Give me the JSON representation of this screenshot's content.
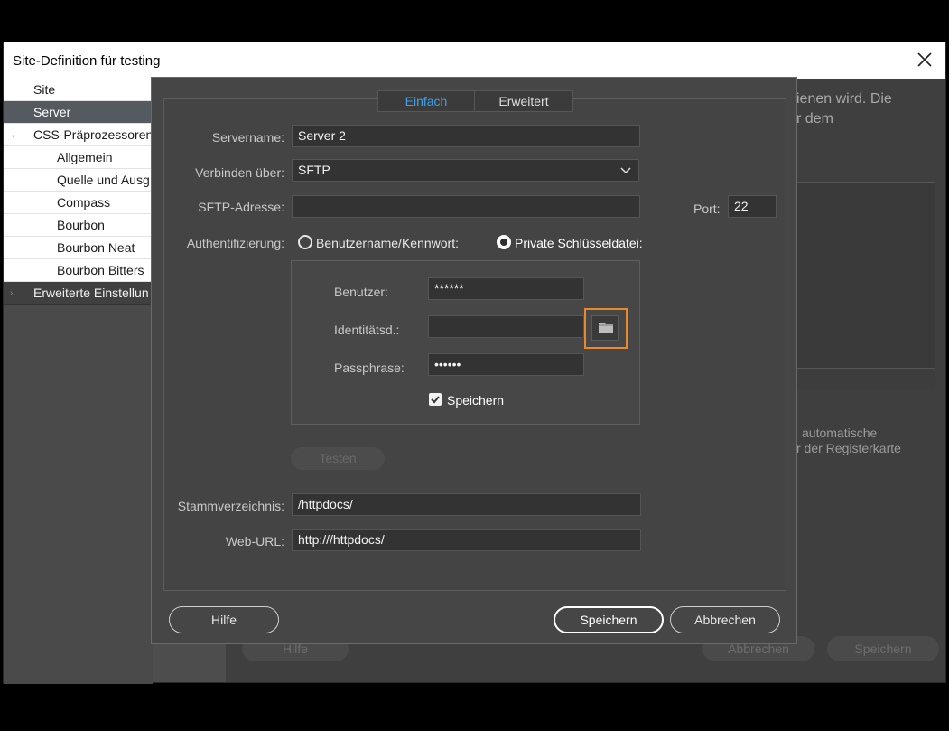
{
  "window": {
    "title": "Site-Definition für testing",
    "close_icon": "close-icon"
  },
  "nav": {
    "items": [
      {
        "label": "Site",
        "selected": false
      },
      {
        "label": "Server",
        "selected": true
      },
      {
        "label": "CSS-Präprozessoren",
        "selected": false,
        "expanded": true
      },
      {
        "label": "Allgemein",
        "selected": false
      },
      {
        "label": "Quelle und Ausg",
        "selected": false
      },
      {
        "label": "Compass",
        "selected": false
      },
      {
        "label": "Bourbon",
        "selected": false
      },
      {
        "label": "Bourbon Neat",
        "selected": false
      },
      {
        "label": "Bourbon Bitters",
        "selected": false
      },
      {
        "label": "Erweiterte Einstellun",
        "selected": false
      }
    ]
  },
  "background": {
    "text_line1": "ienen wird. Die",
    "text_line2": "r dem",
    "text_line3": "automatische",
    "text_line4": "r der Registerkarte",
    "help_label": "Hilfe",
    "cancel_label": "Abbrechen",
    "save_label": "Speichern"
  },
  "dialog": {
    "tabs": [
      {
        "label": "Einfach",
        "active": true
      },
      {
        "label": "Erweitert",
        "active": false
      }
    ],
    "server_name": {
      "label": "Servername:",
      "value": "Server 2"
    },
    "connect_via": {
      "label": "Verbinden über:",
      "value": "SFTP"
    },
    "sftp_address": {
      "label": "SFTP-Adresse:",
      "value": ""
    },
    "port": {
      "label": "Port:",
      "value": "22"
    },
    "auth": {
      "label": "Authentifizierung:",
      "option_password": "Benutzername/Kennwort:",
      "option_keyfile": "Private Schlüsseldatei:",
      "selected": "keyfile"
    },
    "user": {
      "label": "Benutzer:",
      "value": "******"
    },
    "identity_file": {
      "label": "Identitätsd.:",
      "value": "",
      "browse_icon": "folder-icon"
    },
    "passphrase": {
      "label": "Passphrase:",
      "value": "••••••"
    },
    "save_checkbox": {
      "label": "Speichern",
      "checked": true
    },
    "test_button": "Testen",
    "root_dir": {
      "label": "Stammverzeichnis:",
      "value": "/httpdocs/"
    },
    "web_url": {
      "label": "Web-URL:",
      "value": "http:///httpdocs/"
    },
    "help_button": "Hilfe",
    "save_button": "Speichern",
    "cancel_button": "Abbrechen"
  },
  "colors": {
    "accent_tab": "#3ea0e8",
    "highlight_border": "#e88a2a",
    "nav_selected": "#555a60"
  }
}
